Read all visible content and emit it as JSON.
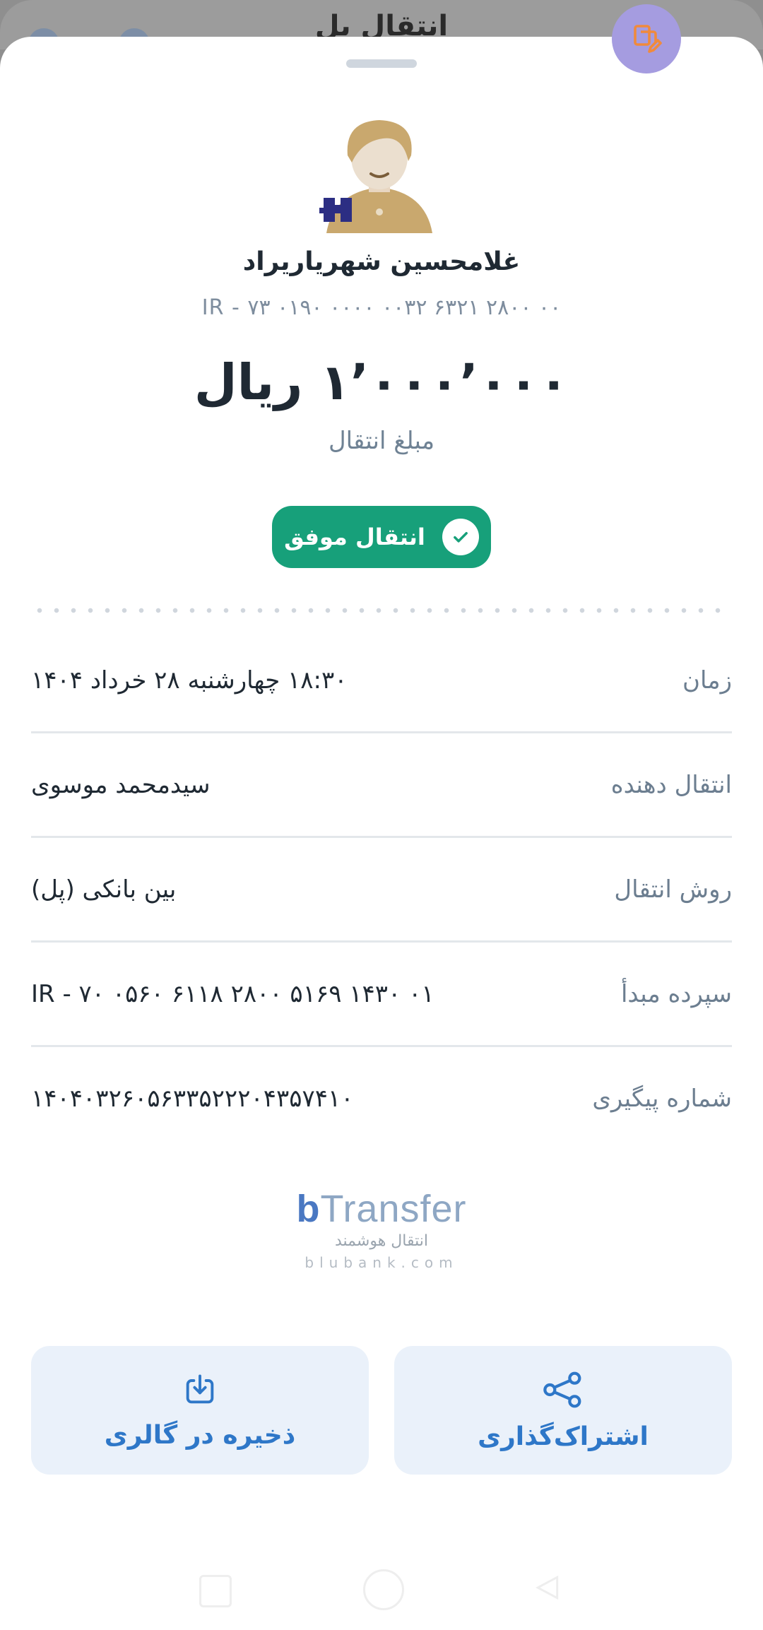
{
  "header": {
    "title": "انتقال پل"
  },
  "fab": {
    "icon": "copy-edit-icon"
  },
  "recipient": {
    "name": "غلامحسین شهریاریراد",
    "iban": "IR - ۷۳ ۰۱۹۰ ۰۰۰۰ ۰۰۳۲ ۶۳۲۱ ۲۸۰۰ ۰۰",
    "bank_logo": "saderat-bank-logo"
  },
  "amount": {
    "value": "۱٬۰۰۰٬۰۰۰ ریال",
    "label": "مبلغ انتقال"
  },
  "status": {
    "label": "انتقال موفق",
    "icon": "check-icon",
    "color": "#17a07a"
  },
  "details": [
    {
      "label": "زمان",
      "value": "۱۸:۳۰ چهارشنبه ۲۸ خرداد ۱۴۰۴"
    },
    {
      "label": "انتقال دهنده",
      "value": "سیدمحمد موسوی"
    },
    {
      "label": "روش انتقال",
      "value": "بین بانکی (پل)"
    },
    {
      "label": "سپرده مبدأ",
      "value": "IR - ۷۰ ۰۵۶۰ ۶۱۱۸ ۲۸۰۰ ۵۱۶۹ ۱۴۳۰ ۰۱"
    },
    {
      "label": "شماره پیگیری",
      "value": "۱۴۰۴۰۳۲۶۰۵۶۳۳۵۲۲۲۰۴۳۵۷۴۱۰"
    }
  ],
  "branding": {
    "logo_b": "b",
    "logo_text": "Transfer",
    "tagline": "انتقال هوشمند",
    "url": "blubank.com"
  },
  "actions": {
    "save": {
      "label": "ذخیره در گالری",
      "icon": "download-icon"
    },
    "share": {
      "label": "اشتراک‌گذاری",
      "icon": "share-icon"
    }
  },
  "colors": {
    "accent": "#2e77c8",
    "success": "#17a07a",
    "fab": "#a59ce0"
  }
}
